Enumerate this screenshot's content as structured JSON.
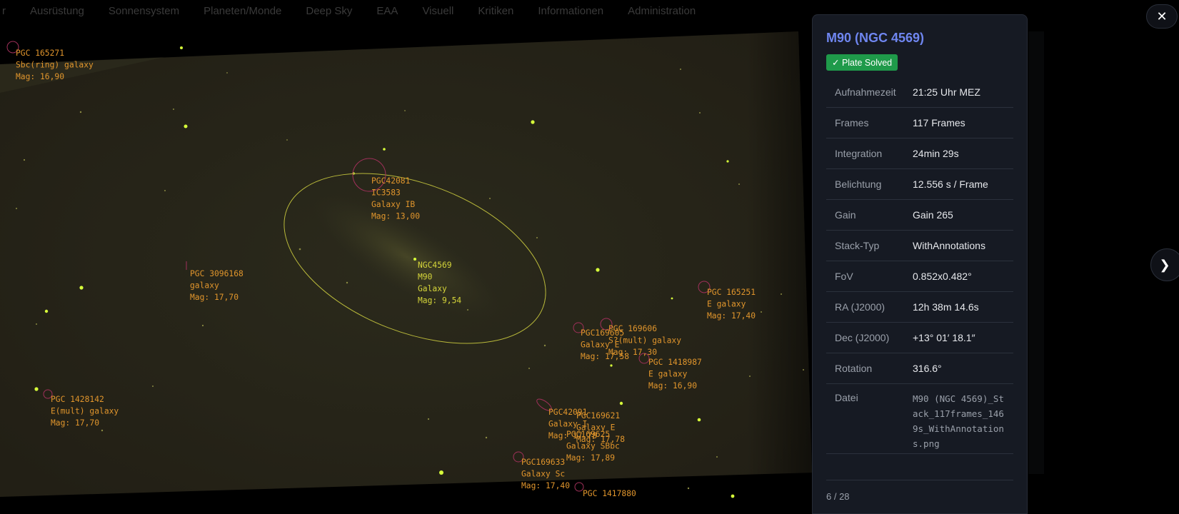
{
  "nav": {
    "items": [
      "r",
      "Ausrüstung",
      "Sonnensystem",
      "Planeten/Monde",
      "Deep Sky",
      "EAA",
      "Visuell",
      "Kritiken",
      "Informationen",
      "Administration"
    ]
  },
  "annotations": {
    "pgc165271": [
      "PGC 165271",
      "Sbc(ring) galaxy",
      "Mag: 16,90"
    ],
    "pgc42081": [
      "PGC42081",
      "IC3583",
      "Galaxy IB",
      "Mag: 13,00"
    ],
    "ngc4569": [
      "NGC4569",
      "M90",
      "Galaxy",
      "Mag: 9,54"
    ],
    "pgc3096168": [
      "PGC 3096168",
      "galaxy",
      "Mag: 17,70"
    ],
    "pgc165251": [
      "PGC 165251",
      "E galaxy",
      "Mag: 17,40"
    ],
    "pgc169605": [
      "PGC169605",
      "Galaxy E",
      "Mag: 17,58"
    ],
    "pgc169606": [
      "PGC 169606",
      "S?(mult) galaxy",
      "Mag: 17,30"
    ],
    "pgc1418987": [
      "PGC 1418987",
      "E galaxy",
      "Mag: 16,90"
    ],
    "pgc1428142": [
      "PGC 1428142",
      "E(mult) galaxy",
      "Mag: 17,70"
    ],
    "pgc42091": [
      "PGC42091",
      "Galaxy I",
      "Mag: 17,78"
    ],
    "pgc169621": [
      "PGC169621",
      "Galaxy E",
      "Mag: 17,78"
    ],
    "pgc169625": [
      "PGC169625",
      "Galaxy SBbc",
      "Mag: 17,89"
    ],
    "pgc169633": [
      "PGC169633",
      "Galaxy Sc",
      "Mag: 17,40"
    ],
    "pgc1417880": [
      "PGC 1417880"
    ]
  },
  "panel": {
    "title": "M90 (NGC 4569)",
    "badge": "✓ Plate Solved",
    "rows": [
      {
        "label": "Aufnahmezeit",
        "value": "21:25 Uhr MEZ"
      },
      {
        "label": "Frames",
        "value": "117 Frames"
      },
      {
        "label": "Integration",
        "value": "24min 29s"
      },
      {
        "label": "Belichtung",
        "value": "12.556 s / Frame"
      },
      {
        "label": "Gain",
        "value": "Gain 265"
      },
      {
        "label": "Stack-Typ",
        "value": "WithAnnotations"
      },
      {
        "label": "FoV",
        "value": "0.852x0.482°"
      },
      {
        "label": "RA (J2000)",
        "value": "12h 38m 14.6s"
      },
      {
        "label": "Dec (J2000)",
        "value": "+13° 01′ 18.1″"
      },
      {
        "label": "Rotation",
        "value": "316.6°"
      }
    ],
    "file_label": "Datei",
    "file_value": "M90 (NGC 4569)_Stack_117frames_1469s_WithAnnotations.png",
    "counter": "6 / 28"
  },
  "controls": {
    "close_icon": "✕",
    "next_icon": "❯"
  },
  "colors": {
    "annotation": "#e0952c",
    "main_target": "#d6d63a",
    "marker": "#a0305a",
    "title": "#6f86f0",
    "badge": "#1f9a4a"
  }
}
